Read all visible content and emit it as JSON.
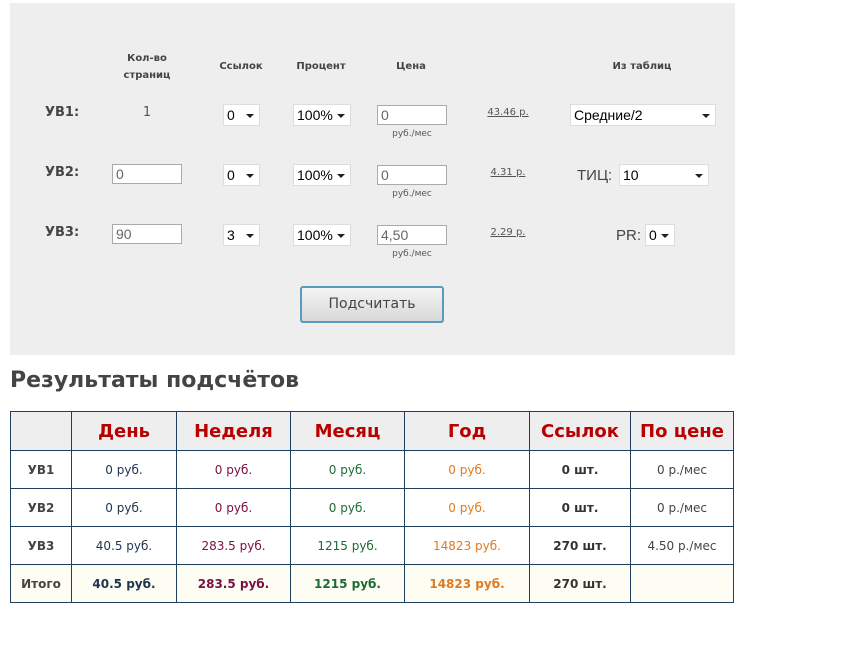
{
  "form": {
    "headers": {
      "pages": "Кол-во\nстраниц",
      "links": "Ссылок",
      "percent": "Процент",
      "price": "Цена",
      "from_tables": "Из таблиц"
    },
    "rows": [
      {
        "label": "УВ1:",
        "pages": "1",
        "links": "0",
        "percent": "100%",
        "price": "0",
        "unit": "руб./мес",
        "calc": "43.46 р.",
        "extra_label": "",
        "extra_value": "Средние/2"
      },
      {
        "label": "УВ2:",
        "pages": "0",
        "links": "0",
        "percent": "100%",
        "price": "0",
        "unit": "руб./мес",
        "calc": "4.31 р.",
        "extra_label": "ТИЦ:",
        "extra_value": "10"
      },
      {
        "label": "УВ3:",
        "pages": "90",
        "links": "3",
        "percent": "100%",
        "price": "4,50",
        "unit": "руб./мес",
        "calc": "2.29 р.",
        "extra_label": "PR:",
        "extra_value": "0"
      }
    ],
    "submit": "Подсчитать"
  },
  "results": {
    "title": "Результаты подсчётов",
    "columns": [
      "",
      "День",
      "Неделя",
      "Месяц",
      "Год",
      "Ссылок",
      "По цене"
    ],
    "rows": [
      [
        "УВ1",
        "0 руб.",
        "0 руб.",
        "0 руб.",
        "0 руб.",
        "0 шт.",
        "0 р./мес"
      ],
      [
        "УВ2",
        "0 руб.",
        "0 руб.",
        "0 руб.",
        "0 руб.",
        "0 шт.",
        "0 р./мес"
      ],
      [
        "УВ3",
        "40.5 руб.",
        "283.5 руб.",
        "1215 руб.",
        "14823 руб.",
        "270 шт.",
        "4.50 р./мес"
      ],
      [
        "Итого",
        "40.5 руб.",
        "283.5 руб.",
        "1215 руб.",
        "14823 руб.",
        "270 шт.",
        ""
      ]
    ]
  }
}
